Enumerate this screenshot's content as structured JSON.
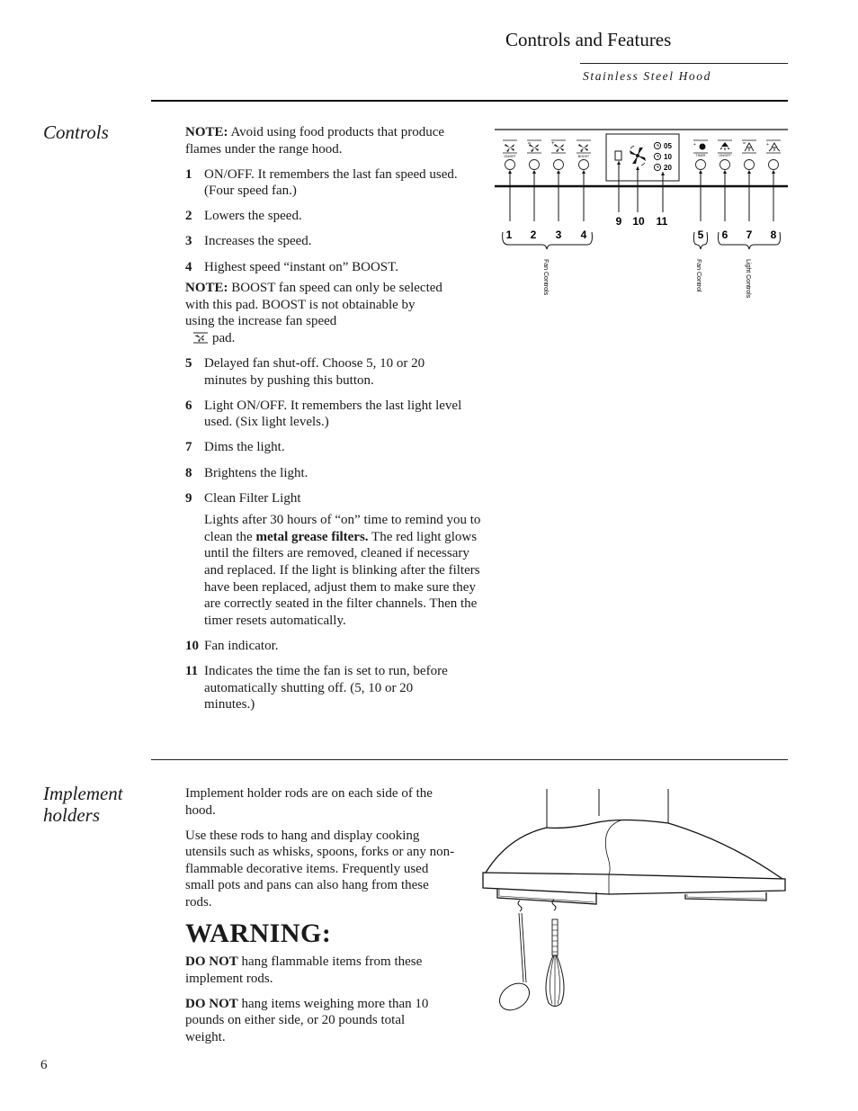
{
  "header": {
    "title": "Controls and Features",
    "subtitle": "Stainless Steel Hood"
  },
  "controls": {
    "heading": "Controls",
    "note1_label": "NOTE:",
    "note1_text": " Avoid using food products that produce flames under the range hood.",
    "items_a": [
      {
        "num": "1",
        "text": "ON/OFF. It remembers the last fan speed used. (Four speed fan.)"
      },
      {
        "num": "2",
        "text": "Lowers the speed."
      },
      {
        "num": "3",
        "text": "Increases the speed."
      },
      {
        "num": "4",
        "text": "Highest speed “instant on” BOOST."
      }
    ],
    "note2_label": "NOTE:",
    "note2_text": " BOOST fan speed can only be selected with this pad. BOOST is not obtainable by using the increase fan speed",
    "note2_icon": "fan-increase-icon",
    "note2_tail": "pad.",
    "items_b": [
      {
        "num": "5",
        "text": "Delayed fan shut-off. Choose 5, 10 or 20 minutes by pushing this button."
      },
      {
        "num": "6",
        "text": "Light ON/OFF. It remembers the last light level used. (Six light levels.)"
      },
      {
        "num": "7",
        "text": "Dims the light."
      },
      {
        "num": "8",
        "text": "Brightens the light."
      },
      {
        "num": "9",
        "text": "Clean Filter Light"
      }
    ],
    "item9_detail_pre": "Lights after 30 hours of “on” time to remind you to clean the ",
    "item9_detail_bold": "metal grease filters.",
    "item9_detail_post": " The red light glows until the filters are removed, cleaned if necessary and replaced. If the light is blinking after the filters have been replaced, adjust them to make sure they are correctly seated in the filter channels. Then the timer resets automatically.",
    "items_c": [
      {
        "num": "10",
        "text": "Fan indicator."
      },
      {
        "num": "11",
        "text": "Indicates the time the fan is set to run, before automatically shutting off. (5, 10 or 20 minutes.)"
      }
    ]
  },
  "diagram": {
    "pad_labels": [
      "ON/OFF",
      "",
      "",
      "BOOST",
      "TIMER",
      "ON/OFF",
      "",
      ""
    ],
    "timer_values": [
      "05",
      "10",
      "20"
    ],
    "callouts_bottom": [
      "1",
      "2",
      "3",
      "4",
      "5",
      "6",
      "7",
      "8"
    ],
    "callouts_display": [
      "9",
      "10",
      "11"
    ],
    "group_labels": {
      "fan_controls": "Fan Controls",
      "fan_control": "Fan Control",
      "light_controls": "Light Controls"
    }
  },
  "implement": {
    "heading_line1": "Implement",
    "heading_line2": "holders",
    "para1": "Implement holder rods are on each side of the hood.",
    "para2": "Use these rods to hang and display cooking utensils such as whisks, spoons, forks or any non-flammable decorative items. Frequently used small pots and pans can also hang from these rods.",
    "warning_title": "WARNING:",
    "warn1_bold": "DO NOT",
    "warn1_text": " hang flammable items from these implement rods.",
    "warn2_bold": "DO NOT",
    "warn2_text": " hang items weighing more than 10 pounds on either side, or 20 pounds total weight."
  },
  "page_number": "6"
}
